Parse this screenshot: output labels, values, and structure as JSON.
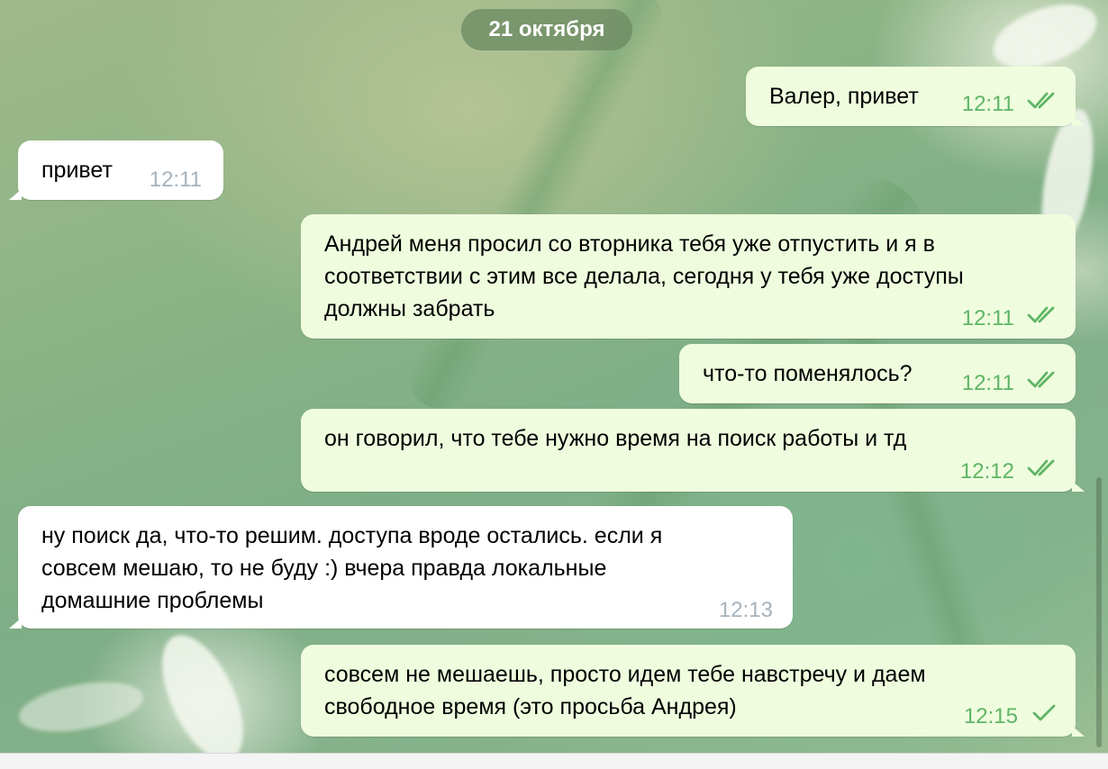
{
  "date_separator": "21 октября",
  "colors": {
    "outgoing_bubble": "#effdde",
    "incoming_bubble": "#ffffff",
    "outgoing_time": "#5fb566",
    "incoming_time": "#a6b3be",
    "date_pill": "#6e8c64"
  },
  "messages": [
    {
      "direction": "outgoing",
      "text": "Валер, привет",
      "time": "12:11",
      "status": "read",
      "status_icon": "double-check-icon"
    },
    {
      "direction": "incoming",
      "text": "привет",
      "time": "12:11"
    },
    {
      "direction": "outgoing",
      "text": "Андрей меня просил со вторника тебя уже отпустить и я в\nсоответствии с этим все делала, сегодня у тебя уже доступы\nдолжны забрать",
      "time": "12:11",
      "status": "read",
      "status_icon": "double-check-icon"
    },
    {
      "direction": "outgoing",
      "text": "что-то поменялось?",
      "time": "12:11",
      "status": "read",
      "status_icon": "double-check-icon"
    },
    {
      "direction": "outgoing",
      "text": "он говорил, что тебе нужно время на поиск работы и тд",
      "time": "12:12",
      "status": "read",
      "status_icon": "double-check-icon"
    },
    {
      "direction": "incoming",
      "text": "ну поиск да, что-то решим. доступа вроде остались. если я\nсовсем мешаю, то не буду :) вчера правда локальные\nдомашние проблемы",
      "time": "12:13"
    },
    {
      "direction": "outgoing",
      "text": "совсем не мешаешь, просто идем тебе навстречу и даем\nсвободное время (это просьба Андрея)",
      "time": "12:15",
      "status": "sent",
      "status_icon": "single-check-icon"
    }
  ]
}
